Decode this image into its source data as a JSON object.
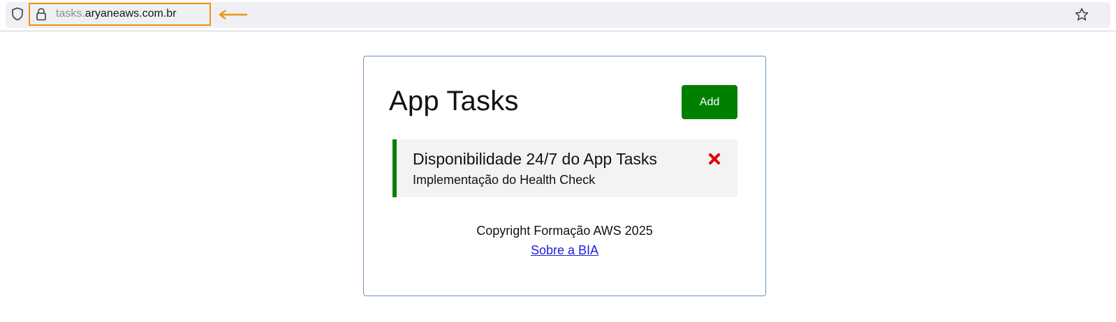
{
  "browser": {
    "url_subdomain": "tasks.",
    "url_domain": "aryaneaws.com.br"
  },
  "app": {
    "title": "App Tasks",
    "add_label": "Add",
    "tasks": [
      {
        "title": "Disponibilidade 24/7 do App Tasks",
        "description": "Implementação do Health Check",
        "delete_symbol": "✖"
      }
    ],
    "footer": {
      "copyright": "Copyright Formação AWS 2025",
      "about_link": "Sobre a BIA"
    }
  },
  "colors": {
    "annotation": "#f2930f",
    "primary_green": "#008000",
    "delete_red": "#e00000",
    "card_border": "#6b93b8"
  },
  "icons": [
    "shield-icon",
    "lock-icon",
    "arrow-left-icon",
    "star-icon",
    "delete-icon"
  ]
}
